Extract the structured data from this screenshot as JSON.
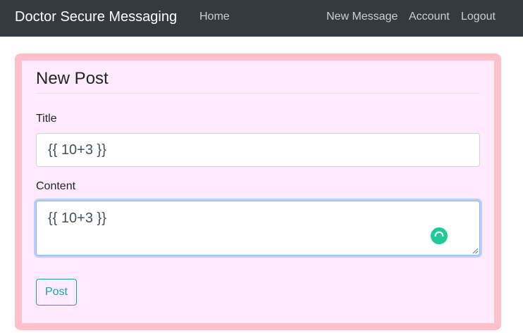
{
  "navbar": {
    "brand": "Doctor Secure Messaging",
    "home_label": "Home",
    "new_message_label": "New Message",
    "account_label": "Account",
    "logout_label": "Logout"
  },
  "form": {
    "heading": "New Post",
    "title_label": "Title",
    "title_value": "{{ 10+3 }}",
    "content_label": "Content",
    "content_value": "{{ 10+3 }}",
    "content_status_icon": "loading-spinner-icon",
    "submit_label": "Post"
  },
  "colors": {
    "navbar_bg": "#343a40",
    "card_border": "#ffc0cb",
    "card_bg": "#ffebfd",
    "button_accent": "#17a2b8",
    "focus_border": "#80bdff",
    "status_icon": "#20c997"
  }
}
